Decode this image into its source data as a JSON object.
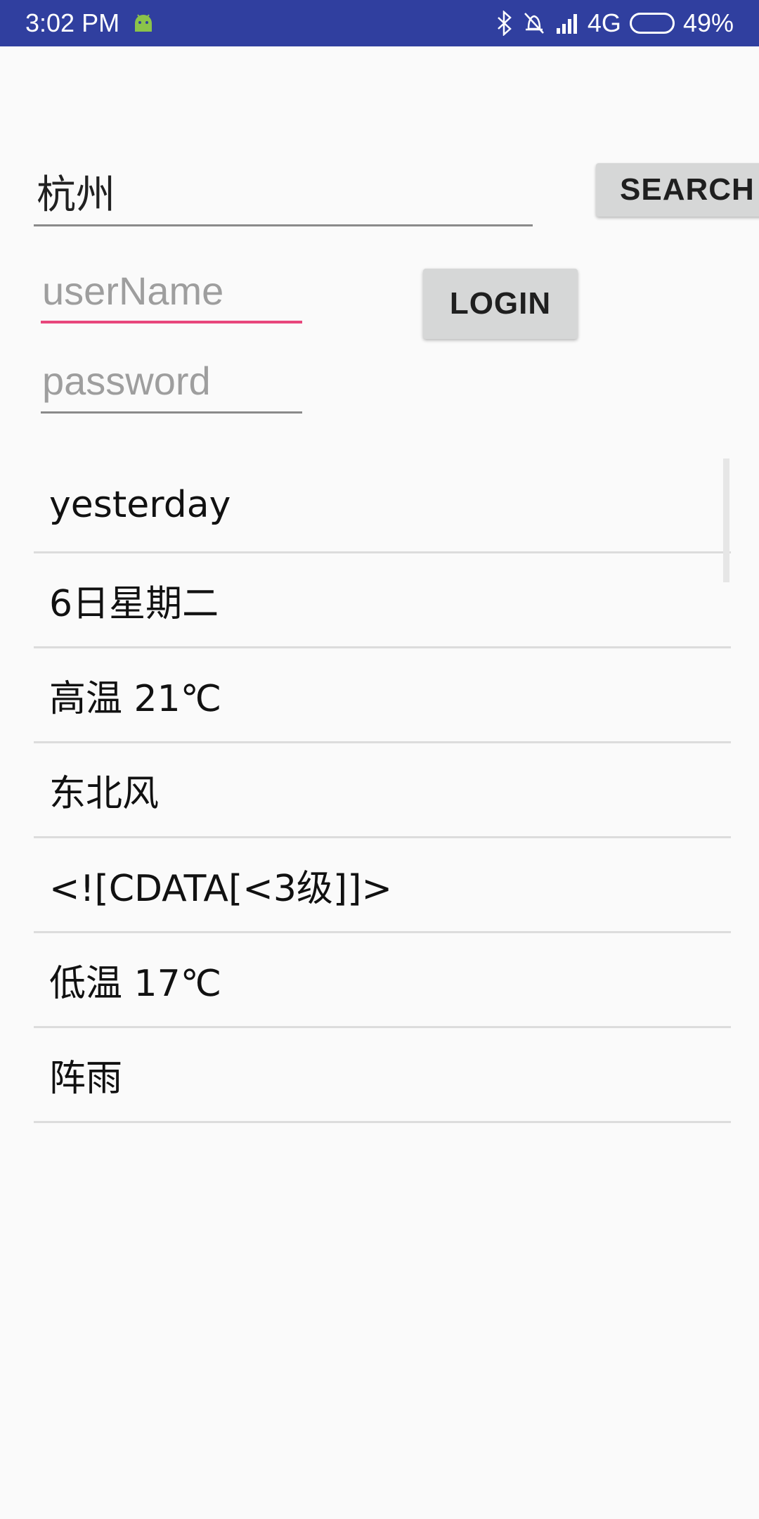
{
  "status_bar": {
    "time": "3:02 PM",
    "icons": [
      "android-icon",
      "bluetooth-icon",
      "alarm-off-icon",
      "signal-icon",
      "battery-icon"
    ],
    "network": "4G",
    "battery": "49%",
    "battery_level": 0.49,
    "color": "#303f9f"
  },
  "search": {
    "city_value": "杭州",
    "button_label": "SEARCH"
  },
  "login": {
    "username_placeholder": "userName",
    "password_placeholder": "password",
    "button_label": "LOGIN",
    "focus_color": "#e8467c"
  },
  "weather_list": {
    "items": [
      "yesterday",
      "6日星期二",
      "高温 21℃",
      "东北风",
      "<![CDATA[<3级]]>",
      "低温 17℃",
      "阵雨"
    ]
  }
}
